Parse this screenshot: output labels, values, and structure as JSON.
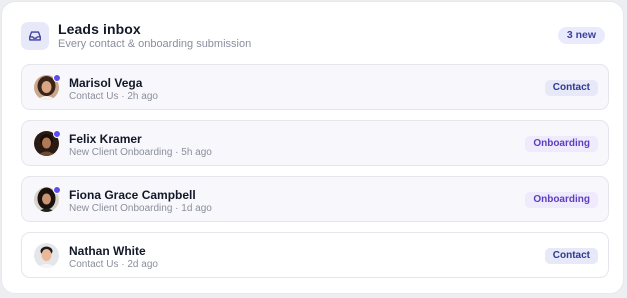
{
  "header": {
    "title": "Leads inbox",
    "subtitle": "Every contact & onboarding submission",
    "new_badge": "3 new",
    "icon": "inbox-icon"
  },
  "colors": {
    "accent": "#5b4df0",
    "contact_tag_bg": "#e7e8f8",
    "contact_tag_text": "#2f3a8f",
    "onboarding_tag_bg": "#efeafc",
    "onboarding_tag_text": "#5b3fc0"
  },
  "leads": [
    {
      "name": "Marisol Vega",
      "meta": "Contact Us · 2h ago",
      "tag": "Contact",
      "unread": true
    },
    {
      "name": "Felix Kramer",
      "meta": "New Client Onboarding · 5h ago",
      "tag": "Onboarding",
      "unread": true
    },
    {
      "name": "Fiona Grace Campbell",
      "meta": "New Client Onboarding · 1d ago",
      "tag": "Onboarding",
      "unread": true
    },
    {
      "name": "Nathan White",
      "meta": "Contact Us · 2d ago",
      "tag": "Contact",
      "unread": false
    }
  ]
}
